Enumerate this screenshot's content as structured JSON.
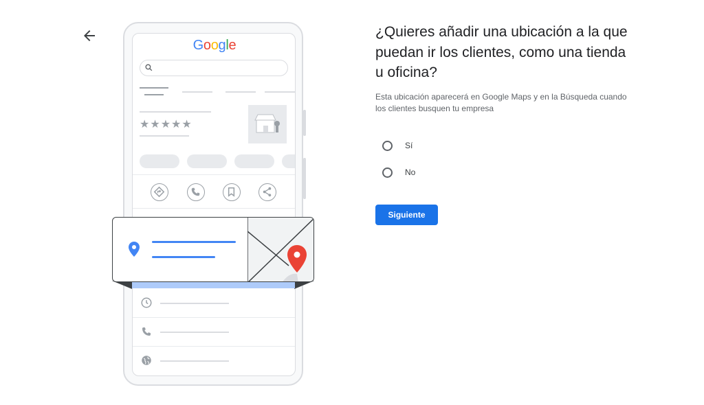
{
  "nav": {
    "back_icon": "arrow-left-icon"
  },
  "illustration": {
    "logo": {
      "G": "G",
      "o1": "o",
      "o2": "o",
      "g": "g",
      "l": "l",
      "e": "e"
    },
    "rating_stars": "★★★★★",
    "icons": [
      "search-icon",
      "storefront-icon",
      "directions-icon",
      "phone-icon",
      "bookmark-icon",
      "share-icon",
      "place-pin-icon",
      "map-pin-icon",
      "clock-icon",
      "phone-icon",
      "globe-icon"
    ],
    "colors": {
      "blue": "#4285f4",
      "red": "#ea4335",
      "yellow": "#fbbc05",
      "green": "#34a853",
      "line_blue": "#1a73e8"
    }
  },
  "question": {
    "title": "¿Quieres añadir una ubicación a la que puedan ir los clientes, como una tienda u oficina?",
    "description": "Esta ubicación aparecerá en Google Maps y en la Búsqueda cuando los clientes busquen tu empresa",
    "options": [
      {
        "label": "Sí"
      },
      {
        "label": "No"
      }
    ],
    "next_label": "Siguiente"
  },
  "colors": {
    "accent": "#1a73e8",
    "text": "#202124",
    "muted": "#5f6368"
  }
}
